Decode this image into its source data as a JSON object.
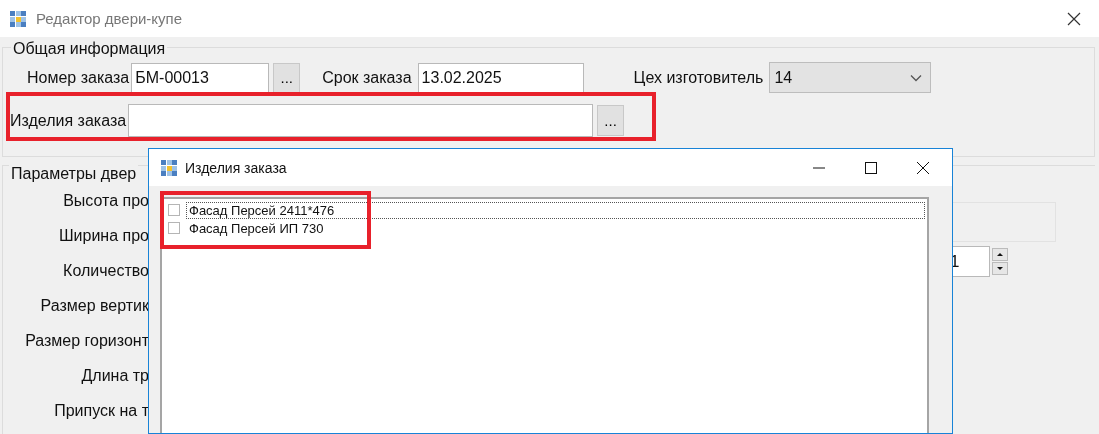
{
  "window": {
    "title": "Редактор двери-купе"
  },
  "general": {
    "caption": "Общая информация",
    "order_number": {
      "label": "Номер заказа",
      "value": "БМ-00013",
      "button": "..."
    },
    "due_date": {
      "label": "Срок заказа",
      "value": "13.02.2025"
    },
    "workshop": {
      "label": "Цех изготовитель",
      "value": "14"
    },
    "order_items": {
      "label": "Изделия заказа",
      "button": "..."
    }
  },
  "door_params": {
    "caption": "Параметры двер",
    "labels": [
      "Высота про",
      "Ширина про",
      "Количество",
      "Размер вертик",
      "Размер горизонт",
      "Длина тр",
      "Припуск на т"
    ],
    "spin_value": "1"
  },
  "dialog": {
    "title": "Изделия заказа",
    "items": [
      {
        "label": "Фасад Персей 2411*476",
        "checked": false,
        "focused": true
      },
      {
        "label": "Фасад Персей ИП 730",
        "checked": false,
        "focused": false
      }
    ]
  }
}
